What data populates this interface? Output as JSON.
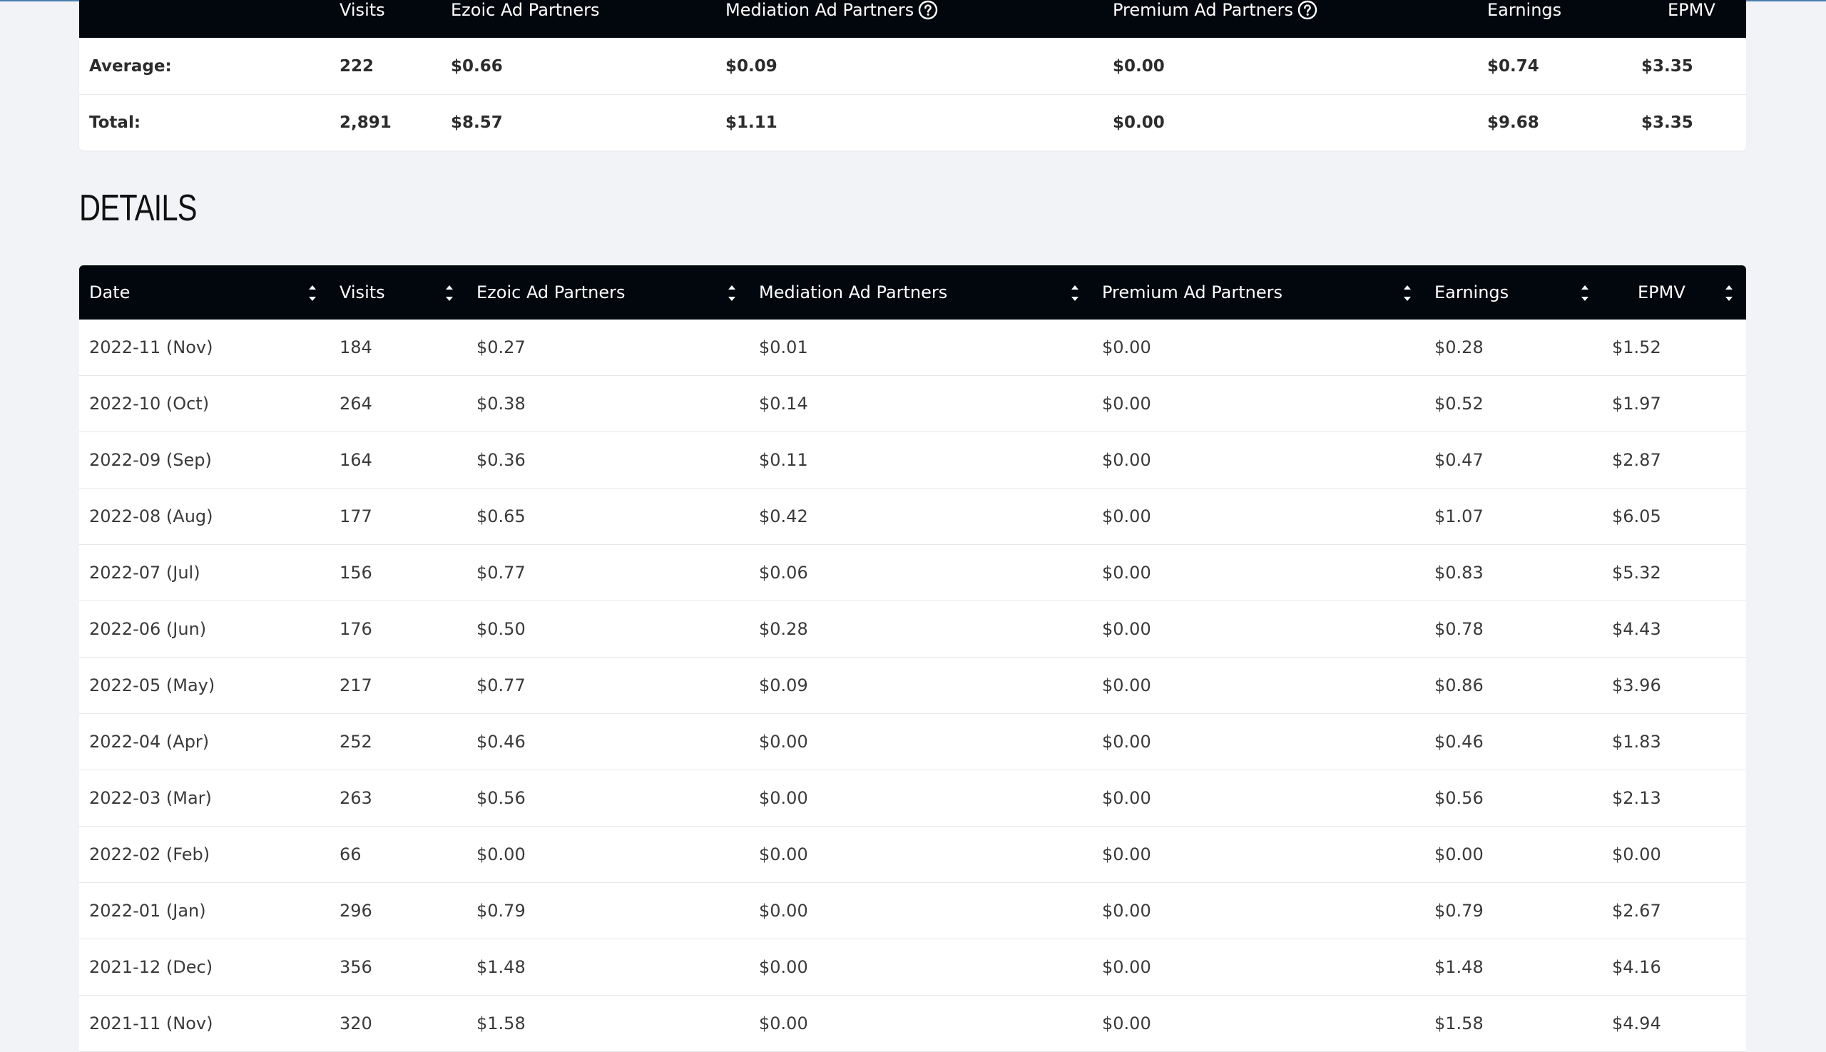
{
  "summary": {
    "headers": {
      "visits": "Visits",
      "ezoic": "Ezoic Ad Partners",
      "mediation": "Mediation Ad Partners",
      "premium": "Premium Ad Partners",
      "earnings": "Earnings",
      "epmv": "EPMV"
    },
    "average": {
      "label": "Average:",
      "visits": "222",
      "ezoic": "$0.66",
      "mediation": "$0.09",
      "premium": "$0.00",
      "earnings": "$0.74",
      "epmv": "$3.35"
    },
    "total": {
      "label": "Total:",
      "visits": "2,891",
      "ezoic": "$8.57",
      "mediation": "$1.11",
      "premium": "$0.00",
      "earnings": "$9.68",
      "epmv": "$3.35"
    }
  },
  "details": {
    "title": "DETAILS",
    "headers": {
      "date": "Date",
      "visits": "Visits",
      "ezoic": "Ezoic Ad Partners",
      "mediation": "Mediation Ad Partners",
      "premium": "Premium Ad Partners",
      "earnings": "Earnings",
      "epmv": "EPMV"
    },
    "rows": [
      {
        "date": "2022-11 (Nov)",
        "visits": "184",
        "ezoic": "$0.27",
        "mediation": "$0.01",
        "premium": "$0.00",
        "earnings": "$0.28",
        "epmv": "$1.52"
      },
      {
        "date": "2022-10 (Oct)",
        "visits": "264",
        "ezoic": "$0.38",
        "mediation": "$0.14",
        "premium": "$0.00",
        "earnings": "$0.52",
        "epmv": "$1.97"
      },
      {
        "date": "2022-09 (Sep)",
        "visits": "164",
        "ezoic": "$0.36",
        "mediation": "$0.11",
        "premium": "$0.00",
        "earnings": "$0.47",
        "epmv": "$2.87"
      },
      {
        "date": "2022-08 (Aug)",
        "visits": "177",
        "ezoic": "$0.65",
        "mediation": "$0.42",
        "premium": "$0.00",
        "earnings": "$1.07",
        "epmv": "$6.05"
      },
      {
        "date": "2022-07 (Jul)",
        "visits": "156",
        "ezoic": "$0.77",
        "mediation": "$0.06",
        "premium": "$0.00",
        "earnings": "$0.83",
        "epmv": "$5.32"
      },
      {
        "date": "2022-06 (Jun)",
        "visits": "176",
        "ezoic": "$0.50",
        "mediation": "$0.28",
        "premium": "$0.00",
        "earnings": "$0.78",
        "epmv": "$4.43"
      },
      {
        "date": "2022-05 (May)",
        "visits": "217",
        "ezoic": "$0.77",
        "mediation": "$0.09",
        "premium": "$0.00",
        "earnings": "$0.86",
        "epmv": "$3.96"
      },
      {
        "date": "2022-04 (Apr)",
        "visits": "252",
        "ezoic": "$0.46",
        "mediation": "$0.00",
        "premium": "$0.00",
        "earnings": "$0.46",
        "epmv": "$1.83"
      },
      {
        "date": "2022-03 (Mar)",
        "visits": "263",
        "ezoic": "$0.56",
        "mediation": "$0.00",
        "premium": "$0.00",
        "earnings": "$0.56",
        "epmv": "$2.13"
      },
      {
        "date": "2022-02 (Feb)",
        "visits": "66",
        "ezoic": "$0.00",
        "mediation": "$0.00",
        "premium": "$0.00",
        "earnings": "$0.00",
        "epmv": "$0.00"
      },
      {
        "date": "2022-01 (Jan)",
        "visits": "296",
        "ezoic": "$0.79",
        "mediation": "$0.00",
        "premium": "$0.00",
        "earnings": "$0.79",
        "epmv": "$2.67"
      },
      {
        "date": "2021-12 (Dec)",
        "visits": "356",
        "ezoic": "$1.48",
        "mediation": "$0.00",
        "premium": "$0.00",
        "earnings": "$1.48",
        "epmv": "$4.16"
      },
      {
        "date": "2021-11 (Nov)",
        "visits": "320",
        "ezoic": "$1.58",
        "mediation": "$0.00",
        "premium": "$0.00",
        "earnings": "$1.58",
        "epmv": "$4.94"
      }
    ]
  },
  "icons": {
    "help": "question-circle-icon",
    "sort": "sort-arrows-icon"
  }
}
